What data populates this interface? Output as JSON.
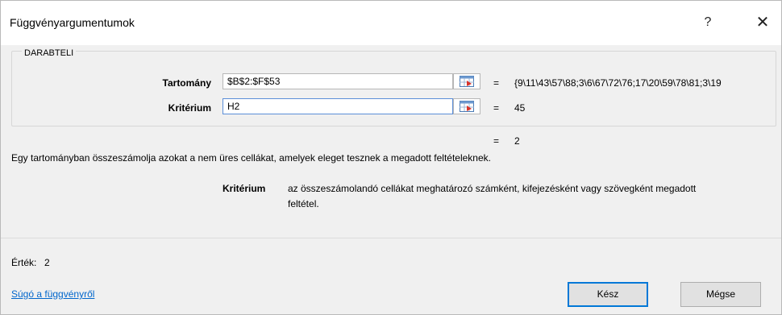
{
  "dialog": {
    "title": "Függvényargumentumok",
    "help_label": "?",
    "close_label": "✕"
  },
  "function_group": {
    "name": "DARABTELI",
    "args": [
      {
        "label": "Tartomány",
        "value": "$B$2:$F$53",
        "equals": "=",
        "result": "{9\\11\\43\\57\\88;3\\6\\67\\72\\76;17\\20\\59\\78\\81;3\\19"
      },
      {
        "label": "Kritérium",
        "value": "H2",
        "equals": "=",
        "result": "45"
      }
    ]
  },
  "formula_result": {
    "equals": "=",
    "value": "2"
  },
  "function_description": "Egy tartományban összeszámolja azokat a nem üres cellákat, amelyek eleget tesznek a megadott feltételeknek.",
  "arg_help": {
    "name": "Kritérium",
    "line1": "az összeszámolandó cellákat meghatározó számként, kifejezésként vagy szövegként megadott",
    "line2": "feltétel."
  },
  "result": {
    "label": "Érték:",
    "value": "2"
  },
  "help_link": "Súgó a függvényről",
  "buttons": {
    "ok": "Kész",
    "cancel": "Mégse"
  }
}
